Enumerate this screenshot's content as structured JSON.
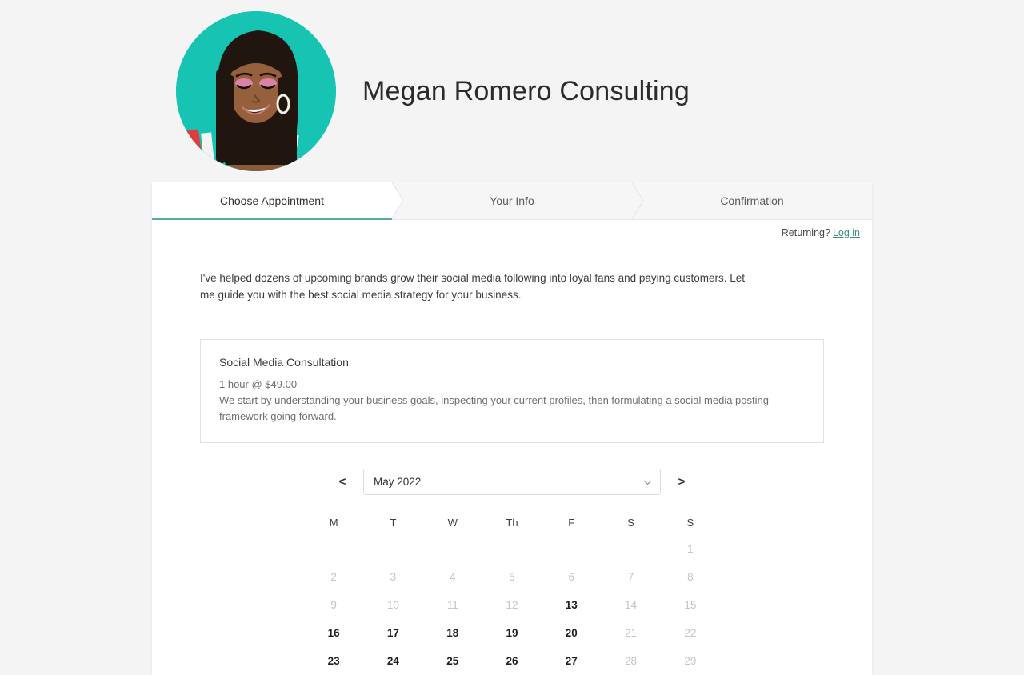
{
  "header": {
    "brand_title": "Megan Romero Consulting",
    "avatar_alt": "avatar",
    "avatar_bg_color": "#17c3b2"
  },
  "tabs": [
    {
      "label": "Choose Appointment",
      "active": true
    },
    {
      "label": "Your Info",
      "active": false
    },
    {
      "label": "Confirmation",
      "active": false
    }
  ],
  "returning": {
    "prompt": "Returning?",
    "login_label": "Log in",
    "link_color": "#3d8b84"
  },
  "intro": {
    "text": "I've helped dozens of upcoming brands grow their social media following into loyal fans and paying customers. Let me guide you with the best social media strategy for your business."
  },
  "service": {
    "name": "Social Media Consultation",
    "price": "1 hour @ $49.00",
    "description": "We start by understanding your business goals, inspecting your current profiles, then formulating a social media posting framework going forward."
  },
  "month_nav": {
    "prev_label": "<",
    "next_label": ">",
    "selected_month": "May 2022",
    "dropdown_icon": "chevron-down-icon"
  },
  "calendar": {
    "weekdays": [
      "M",
      "T",
      "W",
      "Th",
      "F",
      "S",
      "S"
    ],
    "weeks": [
      [
        {
          "day": "",
          "state": "empty"
        },
        {
          "day": "",
          "state": "empty"
        },
        {
          "day": "",
          "state": "empty"
        },
        {
          "day": "",
          "state": "empty"
        },
        {
          "day": "",
          "state": "empty"
        },
        {
          "day": "",
          "state": "empty"
        },
        {
          "day": "1",
          "state": "disabled"
        }
      ],
      [
        {
          "day": "2",
          "state": "disabled"
        },
        {
          "day": "3",
          "state": "disabled"
        },
        {
          "day": "4",
          "state": "disabled"
        },
        {
          "day": "5",
          "state": "disabled"
        },
        {
          "day": "6",
          "state": "disabled"
        },
        {
          "day": "7",
          "state": "disabled"
        },
        {
          "day": "8",
          "state": "disabled"
        }
      ],
      [
        {
          "day": "9",
          "state": "disabled"
        },
        {
          "day": "10",
          "state": "disabled"
        },
        {
          "day": "11",
          "state": "disabled"
        },
        {
          "day": "12",
          "state": "disabled"
        },
        {
          "day": "13",
          "state": "enabled"
        },
        {
          "day": "14",
          "state": "disabled"
        },
        {
          "day": "15",
          "state": "disabled"
        }
      ],
      [
        {
          "day": "16",
          "state": "enabled"
        },
        {
          "day": "17",
          "state": "enabled"
        },
        {
          "day": "18",
          "state": "enabled"
        },
        {
          "day": "19",
          "state": "enabled"
        },
        {
          "day": "20",
          "state": "enabled"
        },
        {
          "day": "21",
          "state": "disabled"
        },
        {
          "day": "22",
          "state": "disabled"
        }
      ],
      [
        {
          "day": "23",
          "state": "enabled"
        },
        {
          "day": "24",
          "state": "enabled"
        },
        {
          "day": "25",
          "state": "enabled"
        },
        {
          "day": "26",
          "state": "enabled"
        },
        {
          "day": "27",
          "state": "enabled"
        },
        {
          "day": "28",
          "state": "disabled"
        },
        {
          "day": "29",
          "state": "disabled"
        }
      ]
    ]
  }
}
